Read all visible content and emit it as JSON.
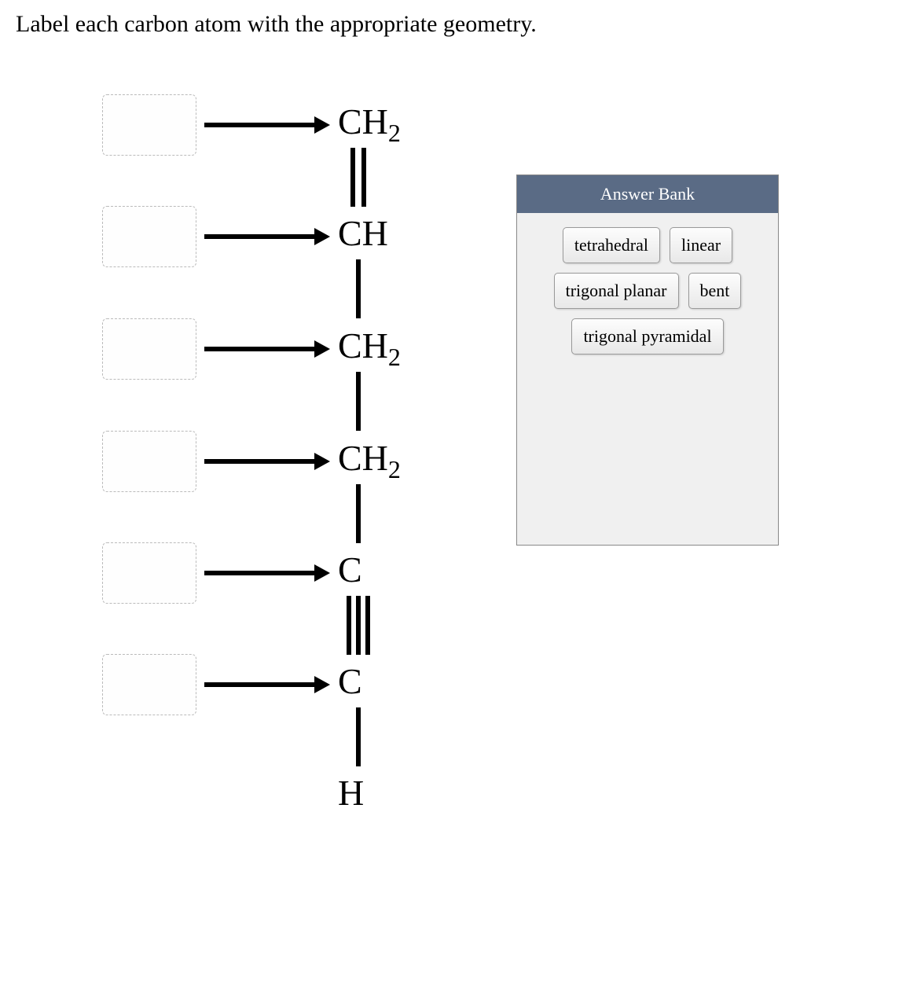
{
  "question": "Label each carbon atom with the appropriate geometry.",
  "atoms": [
    {
      "label": "CH",
      "sub": "2"
    },
    {
      "label": "CH",
      "sub": ""
    },
    {
      "label": "CH",
      "sub": "2"
    },
    {
      "label": "CH",
      "sub": "2"
    },
    {
      "label": "C",
      "sub": ""
    },
    {
      "label": "C",
      "sub": ""
    },
    {
      "label": "H",
      "sub": ""
    }
  ],
  "answer_bank": {
    "title": "Answer Bank",
    "options": [
      "tetrahedral",
      "linear",
      "trigonal planar",
      "bent",
      "trigonal pyramidal"
    ]
  }
}
